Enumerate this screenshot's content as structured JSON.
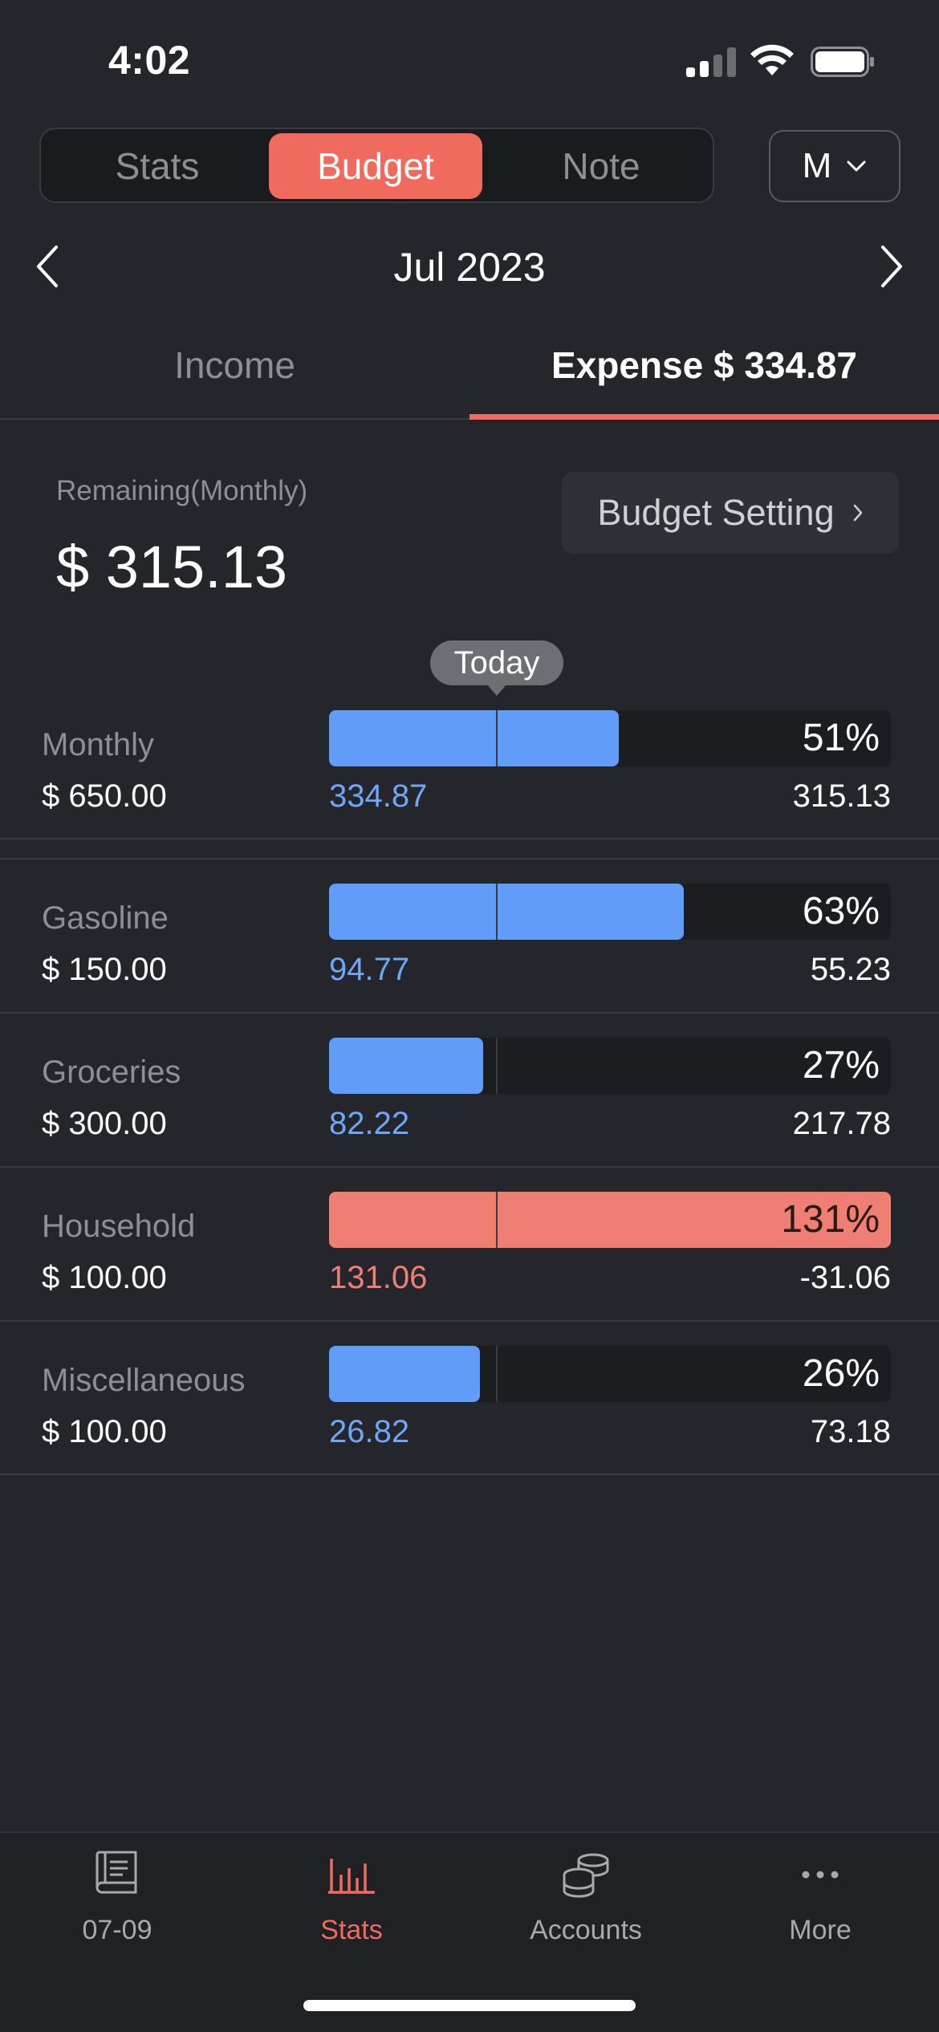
{
  "status_bar": {
    "time": "4:02"
  },
  "segment": {
    "tabs": [
      {
        "label": "Stats",
        "active": false
      },
      {
        "label": "Budget",
        "active": true
      },
      {
        "label": "Note",
        "active": false
      }
    ],
    "period": "M"
  },
  "month": {
    "label": "Jul 2023"
  },
  "tabs": {
    "income": "Income",
    "expense": "Expense $ 334.87"
  },
  "summary": {
    "remaining_label": "Remaining(Monthly)",
    "remaining_value": "$ 315.13",
    "budget_setting_label": "Budget Setting"
  },
  "today_label": "Today",
  "budgets": [
    {
      "name": "Monthly",
      "budget": "$ 650.00",
      "spent": "334.87",
      "left": "315.13",
      "percent": "51%",
      "ratio": 0.515,
      "over": false
    },
    {
      "name": "Gasoline",
      "budget": "$ 150.00",
      "spent": "94.77",
      "left": "55.23",
      "percent": "63%",
      "ratio": 0.632,
      "over": false
    },
    {
      "name": "Groceries",
      "budget": "$ 300.00",
      "spent": "82.22",
      "left": "217.78",
      "percent": "27%",
      "ratio": 0.274,
      "over": false
    },
    {
      "name": "Household",
      "budget": "$ 100.00",
      "spent": "131.06",
      "left": "-31.06",
      "percent": "131%",
      "ratio": 1.0,
      "over": true
    },
    {
      "name": "Miscellaneous",
      "budget": "$ 100.00",
      "spent": "26.82",
      "left": "73.18",
      "percent": "26%",
      "ratio": 0.268,
      "over": false
    }
  ],
  "bottom_nav": [
    {
      "label": "07-09",
      "icon": "book-icon",
      "active": false
    },
    {
      "label": "Stats",
      "icon": "bar-chart-icon",
      "active": true
    },
    {
      "label": "Accounts",
      "icon": "coins-icon",
      "active": false
    },
    {
      "label": "More",
      "icon": "more-icon",
      "active": false
    }
  ],
  "colors": {
    "accent": "#f06b5e",
    "spent": "#619cf9",
    "over": "#ef7f73",
    "background": "#25262b"
  }
}
